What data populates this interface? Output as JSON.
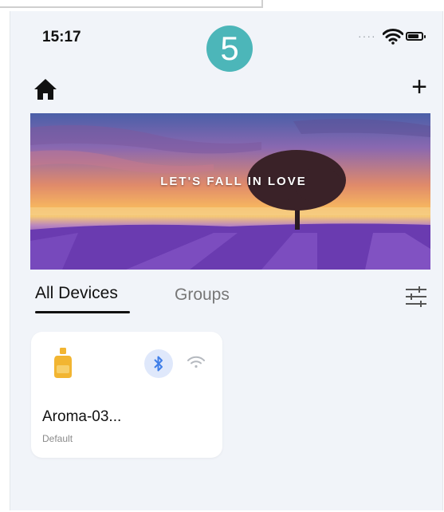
{
  "status": {
    "time": "15:17"
  },
  "step_badge": "5",
  "header": {
    "add_label": "+"
  },
  "banner": {
    "text": "LET'S FALL IN LOVE"
  },
  "tabs": [
    {
      "label": "All Devices",
      "active": true
    },
    {
      "label": "Groups",
      "active": false
    }
  ],
  "device": {
    "name": "Aroma-03...",
    "group": "Default",
    "connectivity_icons": [
      "bluetooth-icon",
      "wifi-icon"
    ]
  },
  "colors": {
    "badge": "#4cb6b9",
    "background": "#f1f4f9",
    "device_icon": "#f2b531",
    "bluetooth": "#3f7ee8"
  }
}
